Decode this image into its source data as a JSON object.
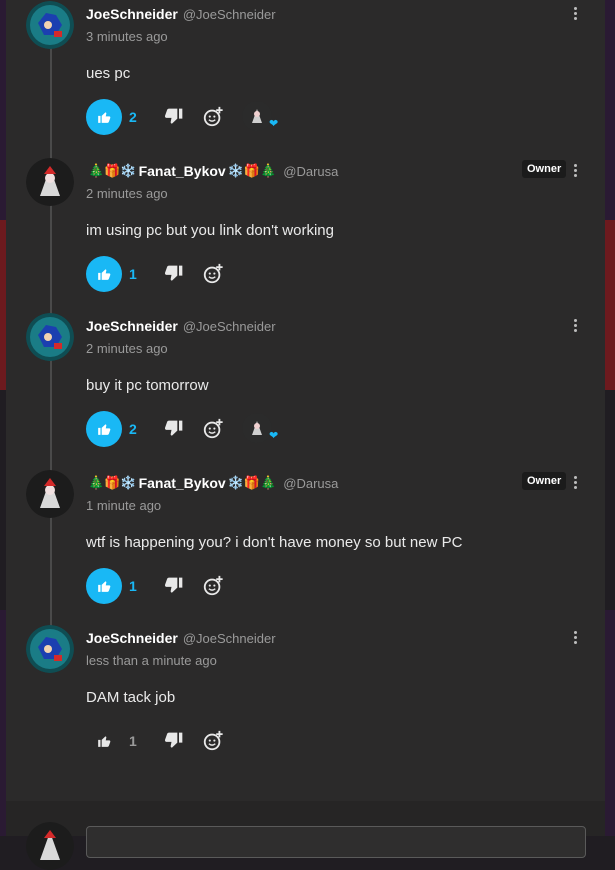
{
  "comments": [
    {
      "author": "JoeSchneider",
      "handle": "@JoeSchneider",
      "time": "3 minutes ago",
      "text": "ues pc",
      "likes": "2",
      "liked": true,
      "reaction_avatar": true
    },
    {
      "author": "Fanat_Bykov",
      "emoji_left": "🎄🎁❄️",
      "emoji_right": "❄️🎁🎄",
      "handle": "@Darusa",
      "time": "2 minutes ago",
      "text": "im using pc but you link don't working",
      "likes": "1",
      "liked": true,
      "badge": "Owner"
    },
    {
      "author": "JoeSchneider",
      "handle": "@JoeSchneider",
      "time": "2 minutes ago",
      "text": "buy it pc tomorrow",
      "likes": "2",
      "liked": true,
      "reaction_avatar": true
    },
    {
      "author": "Fanat_Bykov",
      "emoji_left": "🎄🎁❄️",
      "emoji_right": "❄️🎁🎄",
      "handle": "@Darusa",
      "time": "1 minute ago",
      "text": "wtf is happening you? i don't have money so but new PC",
      "likes": "1",
      "liked": true,
      "badge": "Owner"
    },
    {
      "author": "JoeSchneider",
      "handle": "@JoeSchneider",
      "time": "less than a minute ago",
      "text": "DAM  tack job",
      "likes": "1",
      "liked": false
    }
  ],
  "icons": {
    "like": "thumbs-up-icon",
    "dislike": "thumbs-down-icon",
    "react": "add-reaction-icon",
    "menu": "more-vertical-icon",
    "heart": "heart-icon"
  },
  "colors": {
    "accent": "#19b8f5",
    "panel": "#2b2a2a",
    "background": "#201d22"
  }
}
